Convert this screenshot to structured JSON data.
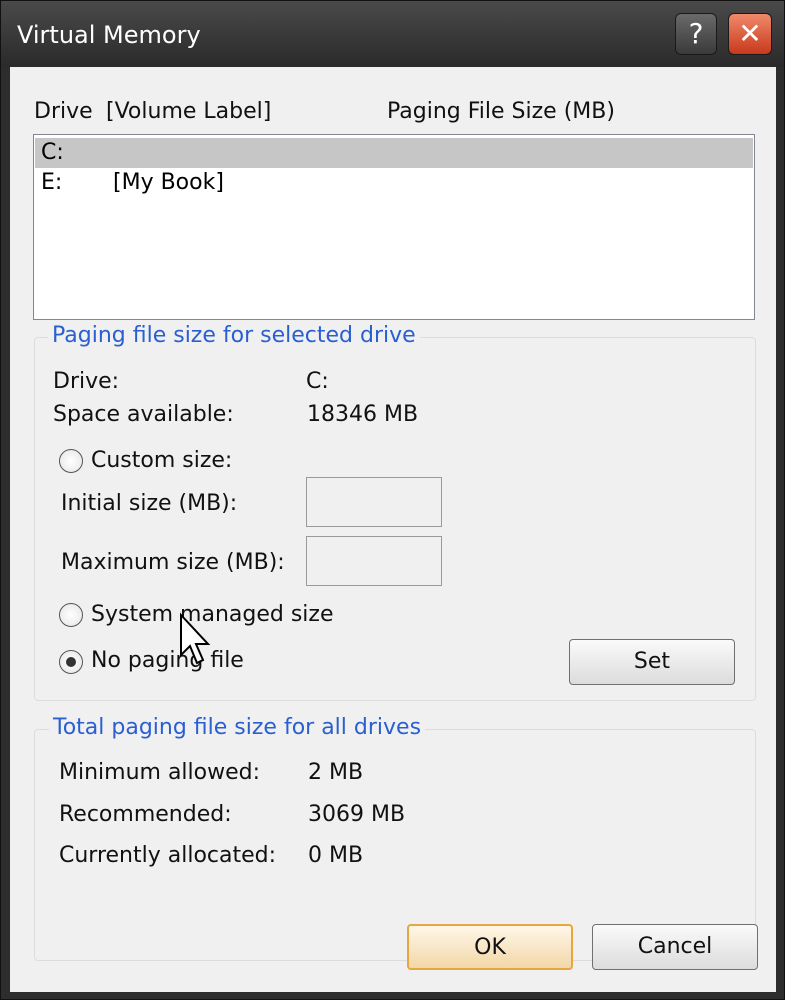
{
  "window": {
    "title": "Virtual Memory",
    "help_glyph": "?",
    "close_glyph": "✕"
  },
  "list": {
    "headers": {
      "drive": "Drive",
      "volume_label": "[Volume Label]",
      "paging_size": "Paging File Size (MB)"
    },
    "rows": [
      {
        "drive": "C:",
        "label": "",
        "size": ""
      },
      {
        "drive": "E:",
        "label": "[My Book]",
        "size": ""
      }
    ],
    "selected_index": 0
  },
  "selected_drive": {
    "group_title": "Paging file size for selected drive",
    "drive_label": "Drive:",
    "drive_value": "C:",
    "space_label": "Space available:",
    "space_value": "18346 MB",
    "custom_size_label": "Custom size:",
    "initial_size_label": "Initial size (MB):",
    "initial_size_value": "",
    "maximum_size_label": "Maximum size (MB):",
    "maximum_size_value": "",
    "system_managed_label": "System managed size",
    "no_paging_label": "No paging file",
    "selected_option": "no_paging",
    "set_button": "Set"
  },
  "totals": {
    "group_title": "Total paging file size for all drives",
    "min_label": "Minimum allowed:",
    "min_value": "2 MB",
    "recommended_label": "Recommended:",
    "recommended_value": "3069 MB",
    "allocated_label": "Currently allocated:",
    "allocated_value": "0 MB"
  },
  "buttons": {
    "ok": "OK",
    "cancel": "Cancel"
  },
  "colors": {
    "accent": "#2a5fd1",
    "close": "#c8391c",
    "default_button_border": "#e6a640"
  }
}
